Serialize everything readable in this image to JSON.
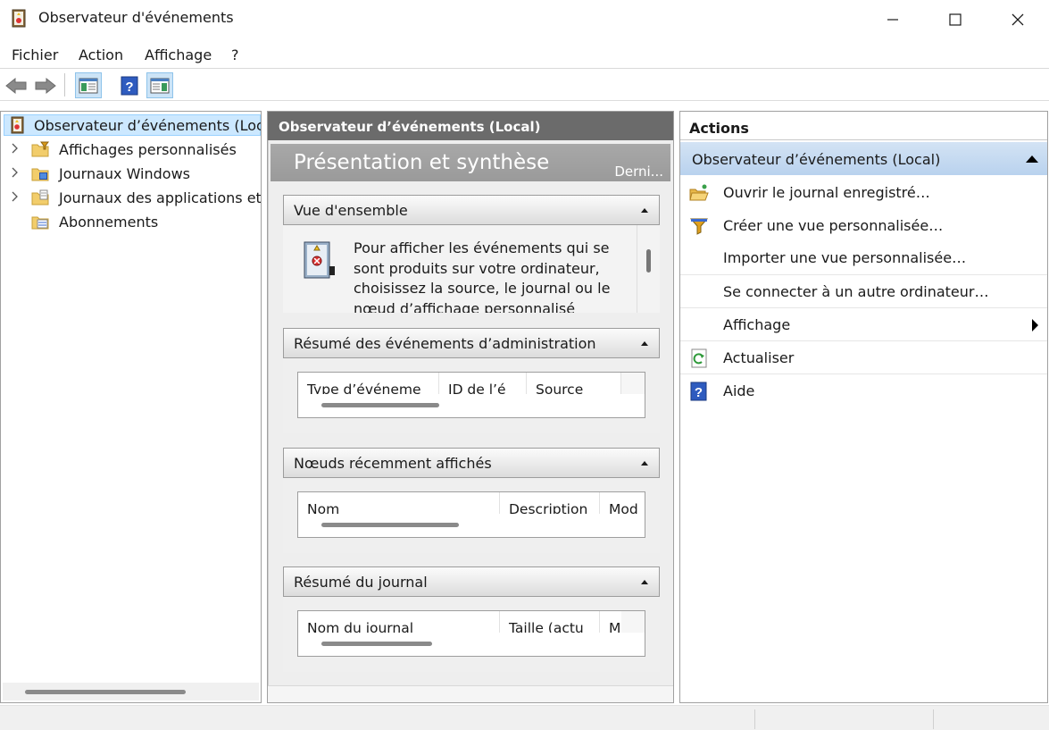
{
  "window": {
    "title": "Observateur d'événements",
    "app_icon": "event-viewer-icon",
    "controls": [
      "minimize-icon",
      "maximize-icon",
      "close-icon"
    ]
  },
  "menu": {
    "items": [
      "Fichier",
      "Action",
      "Affichage",
      "?"
    ]
  },
  "toolbar": {
    "buttons": [
      "back-arrow-icon",
      "forward-arrow-icon",
      "show-hide-console-tree-icon",
      "help-icon",
      "show-hide-action-pane-icon"
    ]
  },
  "tree": {
    "root": "Observateur d’événements (Local)",
    "items": [
      {
        "label": "Affichages personnalisés",
        "icon": "custom-views-folder-icon",
        "expandable": true
      },
      {
        "label": "Journaux Windows",
        "icon": "windows-logs-folder-icon",
        "expandable": true
      },
      {
        "label": "Journaux des applications et des services",
        "icon": "app-logs-folder-icon",
        "expandable": true
      },
      {
        "label": "Abonnements",
        "icon": "subscriptions-icon",
        "expandable": false
      }
    ]
  },
  "center": {
    "header": "Observateur d’événements (Local)",
    "banner_title": "Présentation et synthèse",
    "banner_right": "Derni...",
    "overview": {
      "title": "Vue d'ensemble",
      "text": "Pour afficher les événements qui se sont produits sur votre ordinateur, choisissez la source, le journal ou le nœud d’affichage personnalisé"
    },
    "admin_summary": {
      "title": "Résumé des événements d’administration",
      "columns": [
        "Type d’événeme",
        "ID de l’é",
        "Source"
      ]
    },
    "recent_nodes": {
      "title": "Nœuds récemment affichés",
      "columns": [
        "Nom",
        "Description",
        "Mod"
      ]
    },
    "log_summary": {
      "title": "Résumé du journal",
      "columns": [
        "Nom du journal",
        "Taille (actu",
        "M"
      ]
    }
  },
  "actions": {
    "title": "Actions",
    "group": "Observateur d’événements (Local)",
    "items": [
      {
        "label": "Ouvrir le journal enregistré…",
        "icon": "open-folder-icon"
      },
      {
        "label": "Créer une vue personnalisée…",
        "icon": "filter-icon"
      },
      {
        "label": "Importer une vue personnalisée…",
        "icon": ""
      },
      {
        "label": "Se connecter à un autre ordinateur…",
        "icon": ""
      },
      {
        "label": "Affichage",
        "icon": "",
        "submenu": true
      },
      {
        "label": "Actualiser",
        "icon": "refresh-icon"
      },
      {
        "label": "Aide",
        "icon": "help-icon"
      }
    ]
  },
  "colors": {
    "center_header_bg": "#6b6b6b",
    "banner_bg": "#a0a0a0",
    "tree_selection": "#cce8ff",
    "action_group_bg": "#c4daf2"
  }
}
